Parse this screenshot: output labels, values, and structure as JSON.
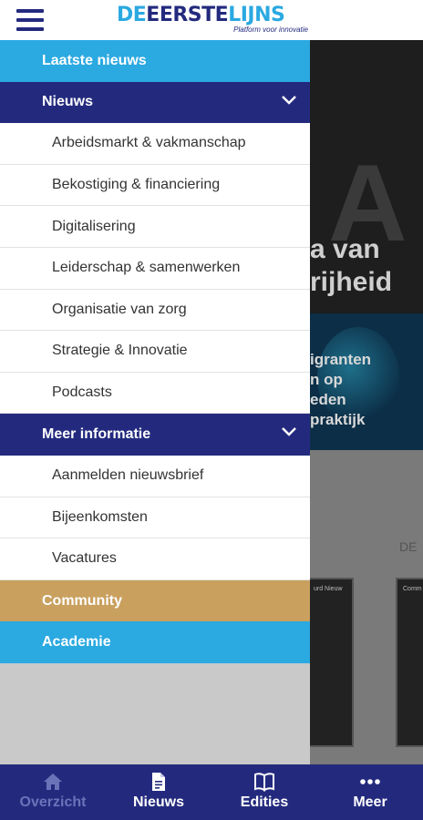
{
  "header": {
    "logo_de": "DE",
    "logo_eerste": "EERSTE",
    "logo_lijns": "LIJNS",
    "logo_tagline": "Platform voor innovatie"
  },
  "drawer": {
    "latest_news": "Laatste nieuws",
    "news": {
      "label": "Nieuws",
      "items": [
        "Arbeidsmarkt & vakmanschap",
        "Bekostiging & financiering",
        "Digitalisering",
        "Leiderschap & samenwerken",
        "Organisatie van zorg",
        "Strategie & Innovatie",
        "Podcasts"
      ]
    },
    "more_info": {
      "label": "Meer informatie",
      "items": [
        "Aanmelden nieuwsbrief",
        "Bijeenkomsten",
        "Vacatures"
      ]
    },
    "community": "Community",
    "academy": "Academie"
  },
  "background": {
    "hero_big_letter": "A",
    "hero_title_line1": "a van",
    "hero_title_line2": "rijheid",
    "card_title_line1": "igranten",
    "card_title_line2": "n op",
    "card_title_line3": "eden",
    "card_title_line4": "praktijk",
    "section_label": "DE",
    "cover1_text": "urd Nieuw",
    "cover2_text": "Comm"
  },
  "bottom_nav": {
    "items": [
      {
        "label": "Overzicht",
        "icon": "home-icon",
        "active": true
      },
      {
        "label": "Nieuws",
        "icon": "document-icon",
        "active": false
      },
      {
        "label": "Edities",
        "icon": "book-icon",
        "active": false
      },
      {
        "label": "Meer",
        "icon": "more-dots-icon",
        "active": false
      }
    ]
  },
  "colors": {
    "navy": "#232a7e",
    "light_blue": "#2ba9e1",
    "gold": "#c9a05e"
  }
}
